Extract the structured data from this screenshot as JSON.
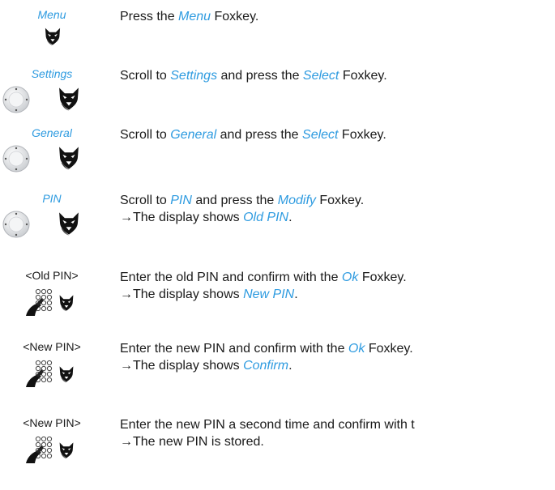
{
  "steps": [
    {
      "label": "Menu",
      "label_style": "italic",
      "icons": [
        "fox-icon"
      ],
      "line1": [
        {
          "t": "Press the "
        },
        {
          "t": "Menu",
          "hl": true
        },
        {
          "t": " Foxkey."
        }
      ],
      "line2": null
    },
    {
      "label": "Settings",
      "label_style": "italic",
      "icons": [
        "navigation-key-icon",
        "fox-icon"
      ],
      "line1": [
        {
          "t": "Scroll to "
        },
        {
          "t": "Settings",
          "hl": true
        },
        {
          "t": " and press the "
        },
        {
          "t": "Select",
          "hl": true
        },
        {
          "t": " Foxkey."
        }
      ],
      "line2": null
    },
    {
      "label": "General",
      "label_style": "italic",
      "icons": [
        "navigation-key-icon",
        "fox-icon"
      ],
      "line1": [
        {
          "t": "Scroll to "
        },
        {
          "t": "General",
          "hl": true
        },
        {
          "t": " and press the "
        },
        {
          "t": "Select",
          "hl": true
        },
        {
          "t": " Foxkey."
        }
      ],
      "line2": null
    },
    {
      "label": "PIN",
      "label_style": "italic",
      "icons": [
        "navigation-key-icon",
        "fox-icon"
      ],
      "line1": [
        {
          "t": "Scroll to "
        },
        {
          "t": "PIN",
          "hl": true
        },
        {
          "t": " and press the "
        },
        {
          "t": "Modify",
          "hl": true
        },
        {
          "t": " Foxkey."
        }
      ],
      "line2": [
        {
          "t": "→",
          "arrow": true
        },
        {
          "t": "The display shows "
        },
        {
          "t": "Old PIN",
          "hl": true
        },
        {
          "t": "."
        }
      ]
    },
    {
      "label": "<Old PIN>",
      "label_style": "plain",
      "icons": [
        "keypad-icon",
        "fox-icon"
      ],
      "line1": [
        {
          "t": "Enter the old PIN and confirm with the "
        },
        {
          "t": "Ok",
          "hl": true
        },
        {
          "t": " Foxkey."
        }
      ],
      "line2": [
        {
          "t": "→",
          "arrow": true
        },
        {
          "t": "The display shows "
        },
        {
          "t": "New PIN",
          "hl": true
        },
        {
          "t": "."
        }
      ]
    },
    {
      "label": "<New PIN>",
      "label_style": "plain",
      "icons": [
        "keypad-icon",
        "fox-icon"
      ],
      "line1": [
        {
          "t": "Enter the new PIN and confirm with the "
        },
        {
          "t": "Ok",
          "hl": true
        },
        {
          "t": " Foxkey."
        }
      ],
      "line2": [
        {
          "t": "→",
          "arrow": true
        },
        {
          "t": "The display shows "
        },
        {
          "t": "Confirm",
          "hl": true
        },
        {
          "t": "."
        }
      ]
    },
    {
      "label": "<New PIN>",
      "label_style": "plain",
      "icons": [
        "keypad-icon",
        "fox-icon"
      ],
      "line1": [
        {
          "t": "Enter the new PIN a second time and confirm with t"
        }
      ],
      "line2": [
        {
          "t": "→",
          "arrow": true
        },
        {
          "t": "The new PIN is stored."
        }
      ]
    }
  ]
}
